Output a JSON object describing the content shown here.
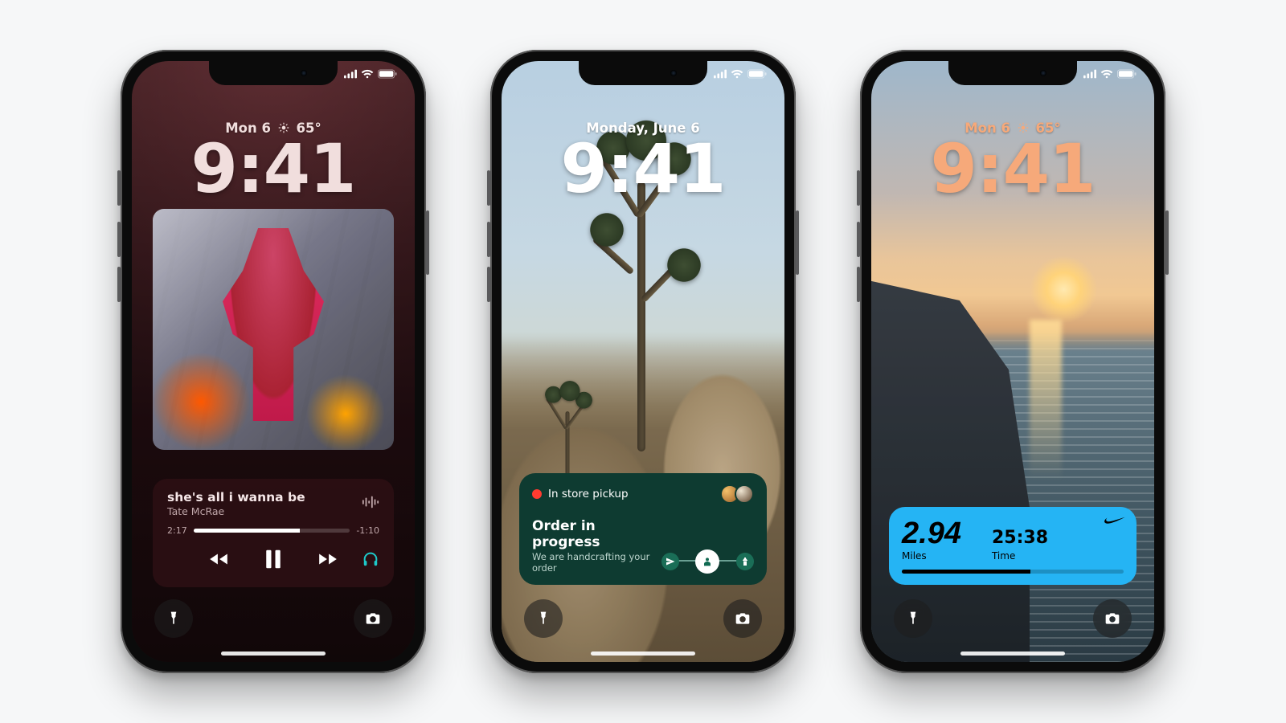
{
  "phone1": {
    "date": "Mon 6",
    "weather_temp": "65°",
    "time": "9:41",
    "music": {
      "title": "she's all i wanna be",
      "artist": "Tate McRae",
      "elapsed": "2:17",
      "remaining": "-1:10",
      "progress_pct": 68,
      "icons": {
        "waveform": "waveform",
        "prev": "backward",
        "pause": "pause",
        "next": "forward",
        "output": "headphones"
      }
    }
  },
  "phone2": {
    "date": "Monday, June 6",
    "time": "9:41",
    "pickup": {
      "status": "In store pickup",
      "title": "Order in progress",
      "subtitle": "We are handcrafting your order",
      "steps": [
        "sent",
        "person",
        "store"
      ]
    }
  },
  "phone3": {
    "date": "Mon 6",
    "weather_temp": "65°",
    "time": "9:41",
    "run": {
      "distance": "2.94",
      "distance_label": "Miles",
      "time": "25:38",
      "time_label": "Time",
      "progress_pct": 58,
      "brand": "nike"
    }
  },
  "shared": {
    "flashlight": "Flashlight",
    "camera": "Camera"
  }
}
